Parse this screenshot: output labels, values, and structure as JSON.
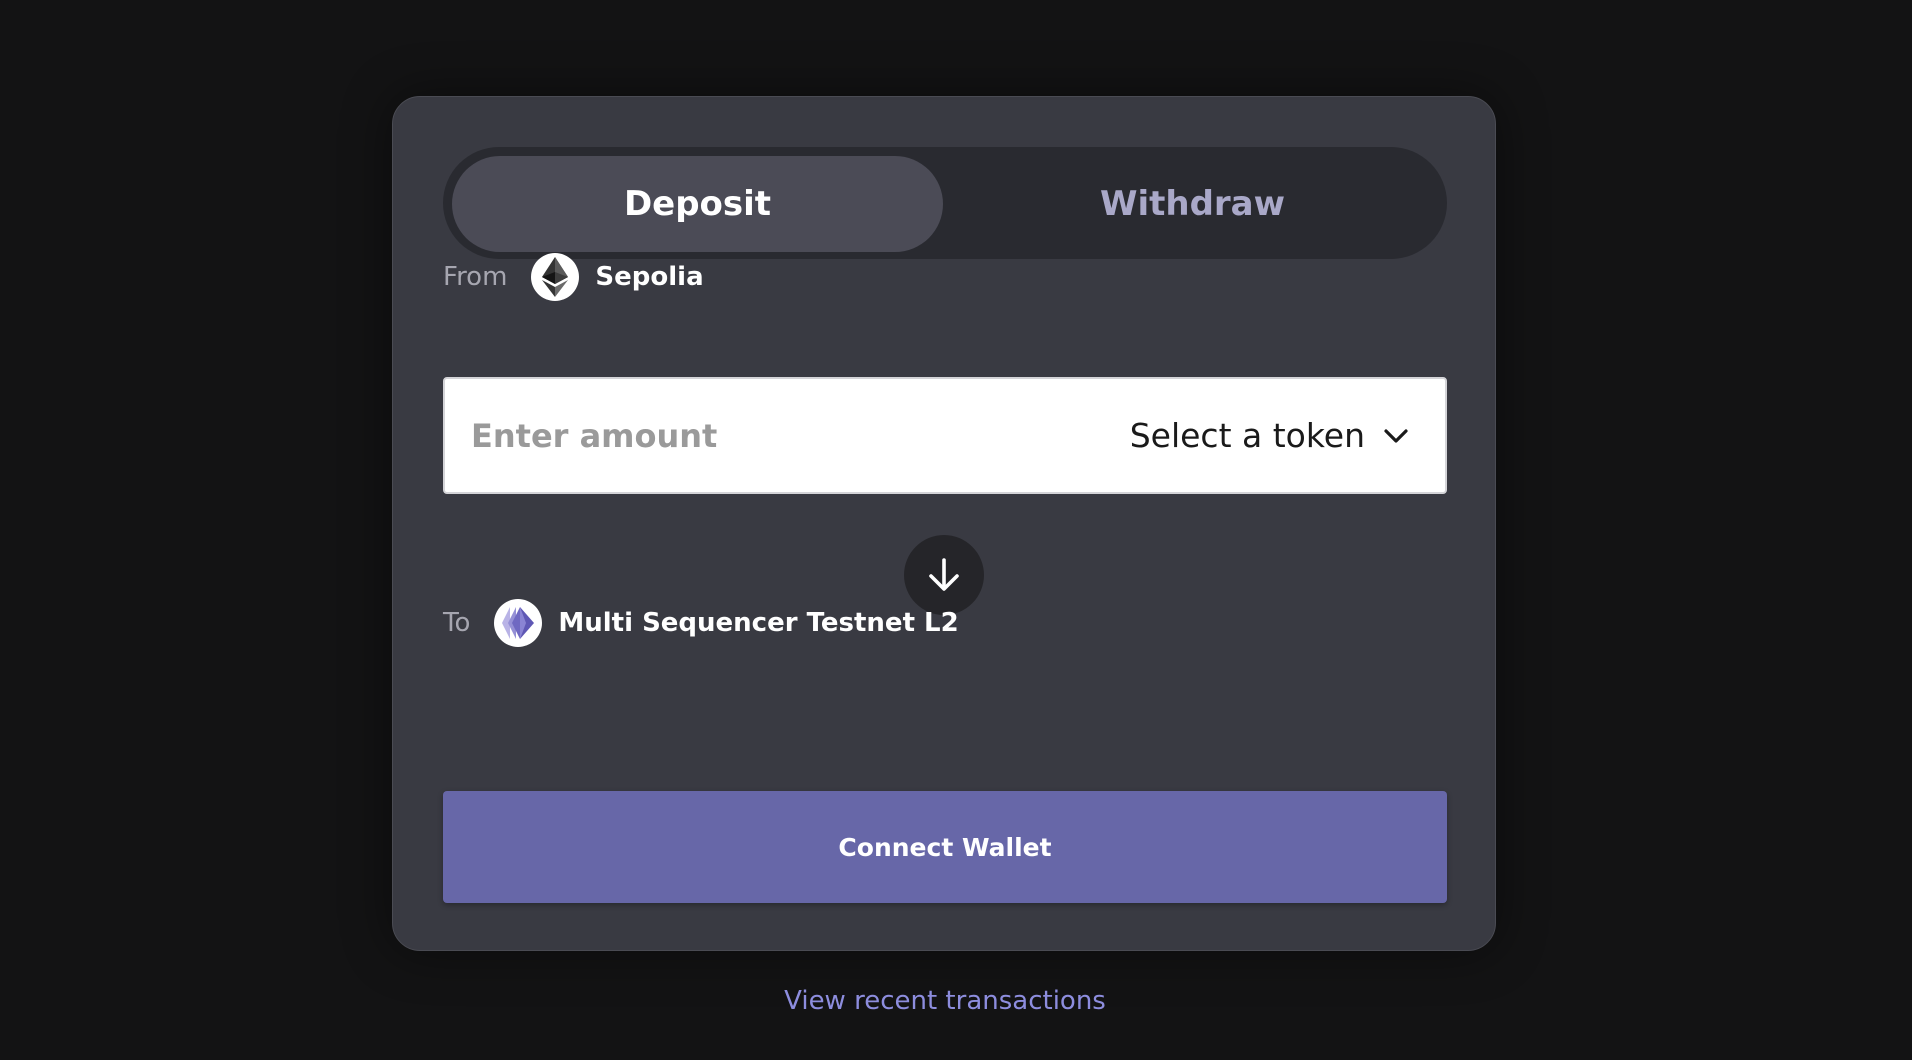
{
  "tabs": [
    {
      "label": "Deposit",
      "active": true
    },
    {
      "label": "Withdraw",
      "active": false
    }
  ],
  "from": {
    "label": "From",
    "network": "Sepolia",
    "icon": "ethereum-icon"
  },
  "amount": {
    "placeholder": "Enter amount",
    "value": ""
  },
  "token_select": {
    "label": "Select a token",
    "icon": "chevron-down-icon"
  },
  "swap": {
    "icon": "arrow-down-icon"
  },
  "to": {
    "label": "To",
    "network": "Multi Sequencer Testnet L2",
    "icon": "l2-network-icon"
  },
  "connect_button": {
    "label": "Connect Wallet"
  },
  "recent_link": {
    "label": "View recent transactions"
  },
  "colors": {
    "page_background": "#131314",
    "card_background": "#393a42",
    "tab_track": "#292a30",
    "tab_active": "#4b4b56",
    "tab_inactive_text": "#a9a8c8",
    "primary_button": "#6767a8",
    "link": "#8d8dde"
  }
}
